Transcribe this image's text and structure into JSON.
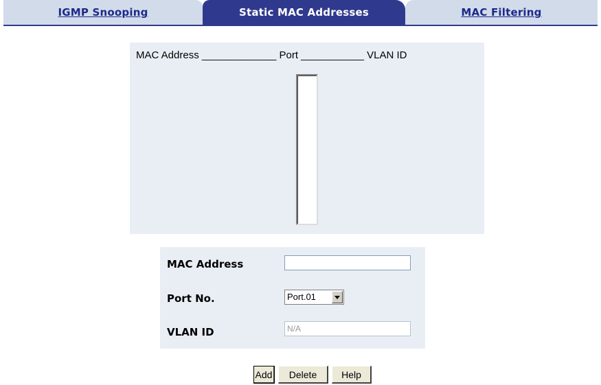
{
  "tabs": [
    {
      "label": "IGMP Snooping",
      "active": false
    },
    {
      "label": "Static MAC Addresses",
      "active": true
    },
    {
      "label": "MAC Filtering",
      "active": false
    }
  ],
  "mac_table": {
    "header": "MAC Address _____________ Port ___________ VLAN ID",
    "entries": []
  },
  "form": {
    "mac_address_label": "MAC Address",
    "mac_address_value": "",
    "port_label": "Port No.",
    "port_value": "Port.01",
    "vlan_label": "VLAN ID",
    "vlan_placeholder": "N/A"
  },
  "buttons": {
    "add": "Add",
    "delete": "Delete",
    "help": "Help"
  },
  "colors": {
    "active_tab": "#2f3a8e",
    "inactive_tab": "#d2dbea",
    "link_text": "#1c2a8a",
    "panel_bg": "#e9eef5"
  }
}
